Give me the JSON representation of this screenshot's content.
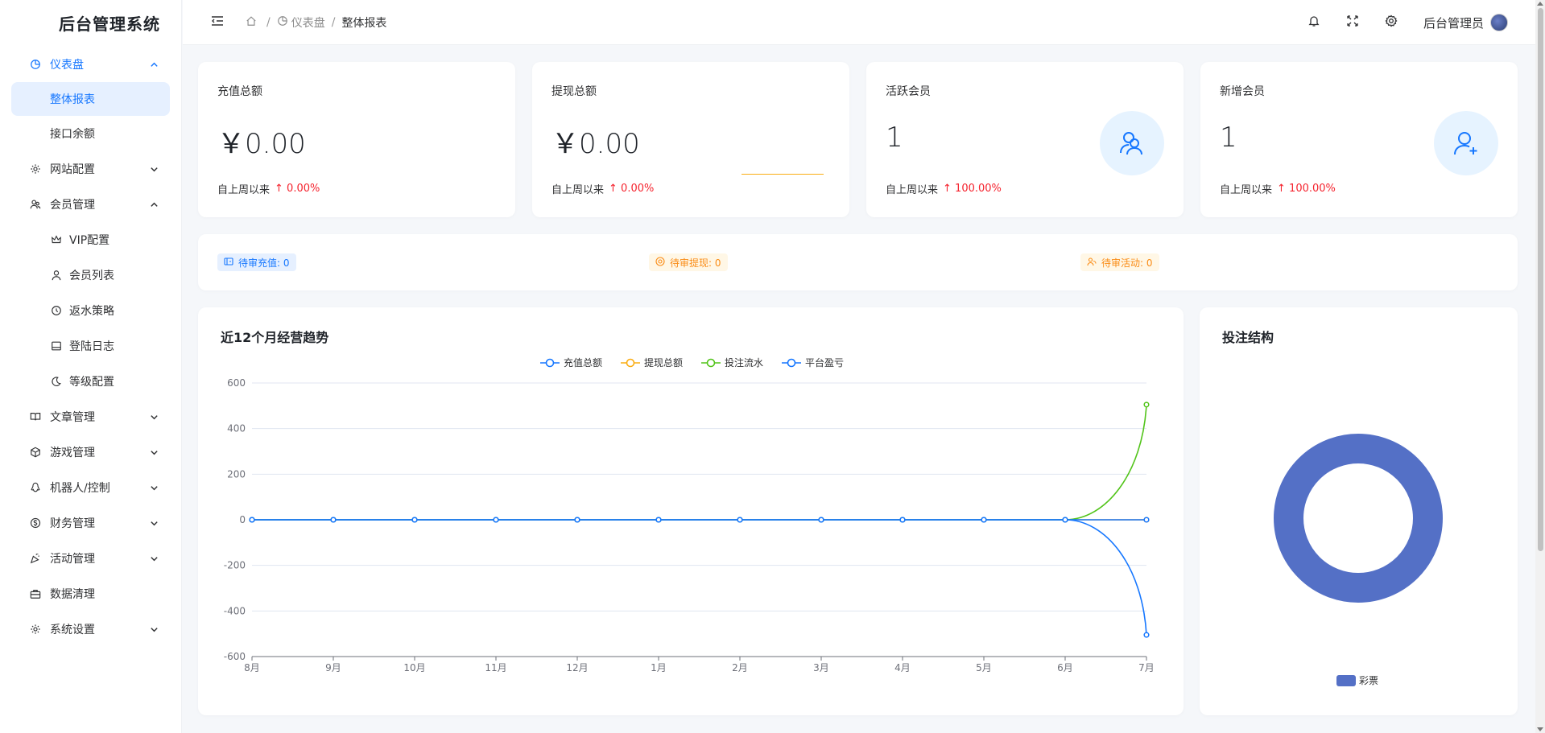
{
  "app": {
    "title": "后台管理系统"
  },
  "sidebar": {
    "items": [
      {
        "key": "dashboard",
        "label": "仪表盘",
        "icon": "dashboard-icon",
        "expanded": true,
        "active": true,
        "children": [
          {
            "label": "整体报表",
            "active": true
          },
          {
            "label": "接口余额"
          }
        ]
      },
      {
        "key": "site",
        "label": "网站配置",
        "icon": "gear-icon",
        "expanded": false
      },
      {
        "key": "member",
        "label": "会员管理",
        "icon": "users-icon",
        "expanded": true,
        "children": [
          {
            "label": "VIP配置",
            "icon": "crown-icon"
          },
          {
            "label": "会员列表",
            "icon": "user-icon"
          },
          {
            "label": "返水策略",
            "icon": "refresh-icon"
          },
          {
            "label": "登陆日志",
            "icon": "monitor-icon"
          },
          {
            "label": "等级配置",
            "icon": "moon-icon"
          }
        ]
      },
      {
        "key": "article",
        "label": "文章管理",
        "icon": "book-icon",
        "expanded": false
      },
      {
        "key": "game",
        "label": "游戏管理",
        "icon": "cube-icon",
        "expanded": false
      },
      {
        "key": "robot",
        "label": "机器人/控制",
        "icon": "penguin-icon",
        "expanded": false
      },
      {
        "key": "finance",
        "label": "财务管理",
        "icon": "dollar-icon",
        "expanded": false
      },
      {
        "key": "activity",
        "label": "活动管理",
        "icon": "gift-icon",
        "expanded": false
      },
      {
        "key": "clean",
        "label": "数据清理",
        "icon": "briefcase-icon"
      },
      {
        "key": "system",
        "label": "系统设置",
        "icon": "gear-icon",
        "expanded": false
      }
    ]
  },
  "header": {
    "breadcrumb": [
      {
        "label": "",
        "icon": "home-icon"
      },
      {
        "label": "仪表盘",
        "icon": "dashboard-icon"
      },
      {
        "label": "整体报表"
      }
    ],
    "user": "后台管理员",
    "icons": [
      "bell-icon",
      "fullscreen-icon",
      "gear-icon"
    ]
  },
  "stats": [
    {
      "title": "充值总额",
      "value": "￥0.00",
      "foot": "自上周以来",
      "change": "0.00%"
    },
    {
      "title": "提现总额",
      "value": "￥0.00",
      "foot": "自上周以来",
      "change": "0.00%"
    },
    {
      "title": "活跃会员",
      "value": "1",
      "foot": "自上周以来",
      "change": "100.00%",
      "icon": "users-icon"
    },
    {
      "title": "新增会员",
      "value": "1",
      "foot": "自上周以来",
      "change": "100.00%",
      "icon": "user-add-icon"
    }
  ],
  "pending": [
    {
      "label": "待审充值: 0",
      "color": "#1677ff"
    },
    {
      "label": "待审提现: 0",
      "color": "#fa8c16"
    },
    {
      "label": "待审活动: 0",
      "color": "#fa8c16"
    }
  ],
  "trend": {
    "title": "近12个月经营趋势"
  },
  "pie": {
    "title": "投注结构"
  },
  "chart_data": [
    {
      "type": "line",
      "title": "近12个月经营趋势",
      "categories": [
        "8月",
        "9月",
        "10月",
        "11月",
        "12月",
        "1月",
        "2月",
        "3月",
        "4月",
        "5月",
        "6月",
        "7月"
      ],
      "ylim": [
        -600,
        600
      ],
      "yticks": [
        600,
        400,
        200,
        0,
        -200,
        -400,
        -600
      ],
      "grid": true,
      "legend": "top-center",
      "series": [
        {
          "name": "充值总额",
          "color": "#1677ff",
          "values": [
            0,
            0,
            0,
            0,
            0,
            0,
            0,
            0,
            0,
            0,
            0,
            0
          ]
        },
        {
          "name": "提现总额",
          "color": "#faad14",
          "values": [
            0,
            0,
            0,
            0,
            0,
            0,
            0,
            0,
            0,
            0,
            0,
            0
          ]
        },
        {
          "name": "投注流水",
          "color": "#52c41a",
          "values": [
            0,
            0,
            0,
            0,
            0,
            0,
            0,
            0,
            0,
            0,
            0,
            505
          ]
        },
        {
          "name": "平台盈亏",
          "color": "#1677ff",
          "values": [
            0,
            0,
            0,
            0,
            0,
            0,
            0,
            0,
            0,
            0,
            0,
            -505
          ]
        }
      ]
    },
    {
      "type": "pie",
      "title": "投注结构",
      "donut": true,
      "legend": "bottom-center",
      "slices": [
        {
          "name": "彩票",
          "value": 100,
          "color": "#5470c6"
        }
      ]
    }
  ]
}
